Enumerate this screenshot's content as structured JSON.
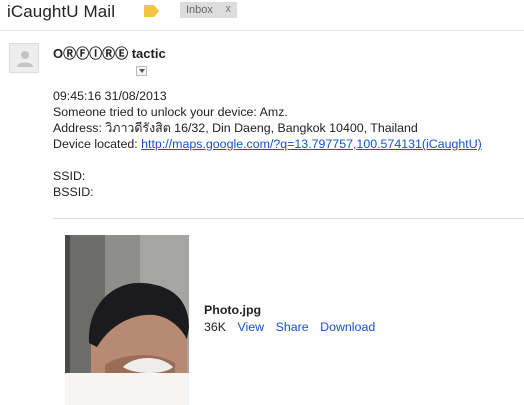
{
  "header": {
    "subject": "iCaughtU Mail",
    "label_inbox": "Inbox",
    "label_remove": "x"
  },
  "message": {
    "sender": "OⓇⒻⒾⓇⒺ tactic",
    "timestamp_line": "09:45:16 31/08/2013",
    "unlock_line": "Someone tried to unlock your device: Amz.",
    "address_line": "Address: วิภาวดีรังสิต 16/32, Din Daeng, Bangkok 10400, Thailand",
    "device_located_label": "Device located: ",
    "device_located_link": "http://maps.google.com/?q=13.797757,100.574131(iCaughtU)",
    "ssid_label": "SSID:",
    "bssid_label": "BSSID:"
  },
  "attachment": {
    "filename": "Photo.jpg",
    "size": "36K",
    "view_label": "View",
    "share_label": "Share",
    "download_label": "Download"
  },
  "colors": {
    "link": "#1155cc",
    "important_marker": "#f4c542",
    "label_chip": "#dddddd"
  },
  "icons": {
    "important": "important-marker-icon",
    "avatar": "person-icon",
    "details": "chevron-down-icon"
  }
}
